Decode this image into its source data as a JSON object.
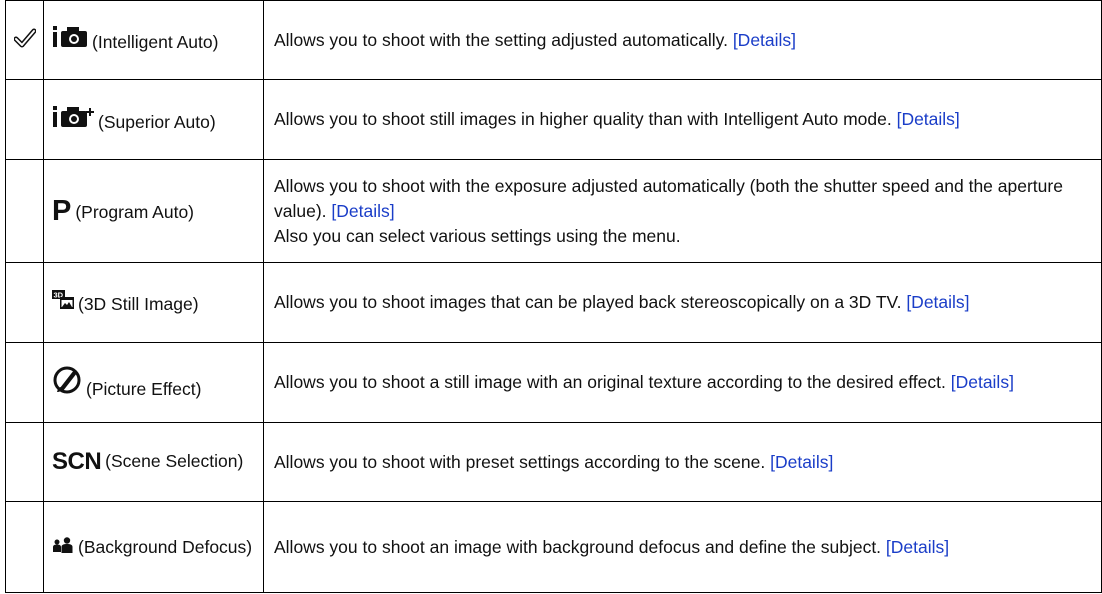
{
  "modes": [
    {
      "selected": true,
      "icon": "intelligent-auto-icon",
      "label": "(Intelligent Auto)",
      "description": "Allows you to shoot with the setting adjusted automatically. ",
      "description_extra": "",
      "link": "[Details]"
    },
    {
      "selected": false,
      "icon": "superior-auto-icon",
      "label": "(Superior Auto)",
      "description": "Allows you to shoot still images in higher quality than with Intelligent Auto mode. ",
      "description_extra": "",
      "link": "[Details]"
    },
    {
      "selected": false,
      "icon": "program-auto-icon",
      "icon_text": "P",
      "label": "(Program Auto)",
      "description": "Allows you to shoot with the exposure adjusted automatically (both the shutter speed and the aperture value). ",
      "description_extra": "Also you can select various settings using the menu.",
      "link": "[Details]"
    },
    {
      "selected": false,
      "icon": "3d-still-image-icon",
      "label": "(3D Still Image)",
      "description": "Allows you to shoot images that can be played back stereoscopically on a 3D TV. ",
      "description_extra": "",
      "link": "[Details]"
    },
    {
      "selected": false,
      "icon": "picture-effect-icon",
      "label": "(Picture Effect)",
      "description": "Allows you to shoot a still image with an original texture according to the desired effect. ",
      "description_extra": "",
      "link": "[Details]"
    },
    {
      "selected": false,
      "icon": "scene-selection-icon",
      "icon_text": "SCN",
      "label": "(Scene Selection)",
      "description": "Allows you to shoot with preset settings according to the scene. ",
      "description_extra": "",
      "link": "[Details]"
    },
    {
      "selected": false,
      "icon": "background-defocus-icon",
      "label": "(Background Defocus)",
      "description": "Allows you to shoot an image with background defocus and define the subject. ",
      "description_extra": "",
      "link": "[Details]"
    }
  ],
  "colors": {
    "link": "#1a3dc8",
    "border": "#000000",
    "text": "#111111"
  }
}
